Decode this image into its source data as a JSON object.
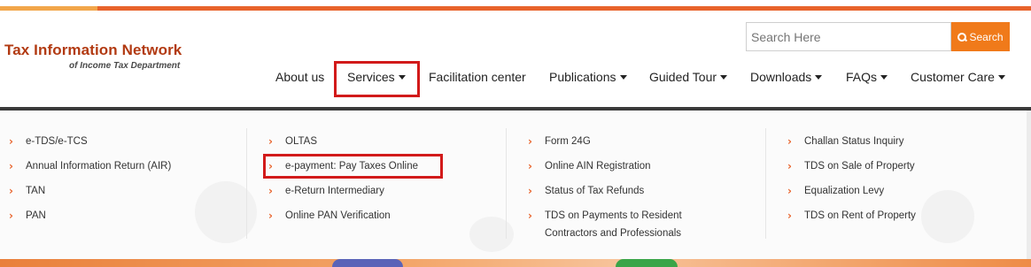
{
  "brand": {
    "title": "Tax Information Network",
    "subtitle": "of Income Tax Department"
  },
  "search": {
    "placeholder": "Search Here",
    "button_label": "Search",
    "button_icon": "search-icon"
  },
  "nav": {
    "items": [
      {
        "label": "About us",
        "has_dropdown": false
      },
      {
        "label": "Services",
        "has_dropdown": true,
        "highlighted": true
      },
      {
        "label": "Facilitation center",
        "has_dropdown": false
      },
      {
        "label": "Publications",
        "has_dropdown": true
      },
      {
        "label": "Guided Tour",
        "has_dropdown": true
      },
      {
        "label": "Downloads",
        "has_dropdown": true
      },
      {
        "label": "FAQs",
        "has_dropdown": true
      },
      {
        "label": "Customer Care",
        "has_dropdown": true
      }
    ]
  },
  "services_menu": {
    "columns": [
      [
        "e-TDS/e-TCS",
        "Annual Information Return (AIR)",
        "TAN",
        "PAN"
      ],
      [
        "OLTAS",
        "e-payment: Pay Taxes Online",
        "e-Return Intermediary",
        "Online PAN Verification"
      ],
      [
        "Form 24G",
        "Online AIN Registration",
        "Status of Tax Refunds",
        "TDS on Payments to Resident",
        "Contractors and Professionals"
      ],
      [
        "Challan Status Inquiry",
        "TDS on Sale of Property",
        "Equalization Levy",
        "TDS on Rent of Property"
      ]
    ],
    "highlighted_item": "e-payment: Pay Taxes Online"
  },
  "colors": {
    "brand": "#b23a12",
    "accent": "#e8632b",
    "search_button": "#f07a1a",
    "highlight_box": "#d21a1a"
  }
}
